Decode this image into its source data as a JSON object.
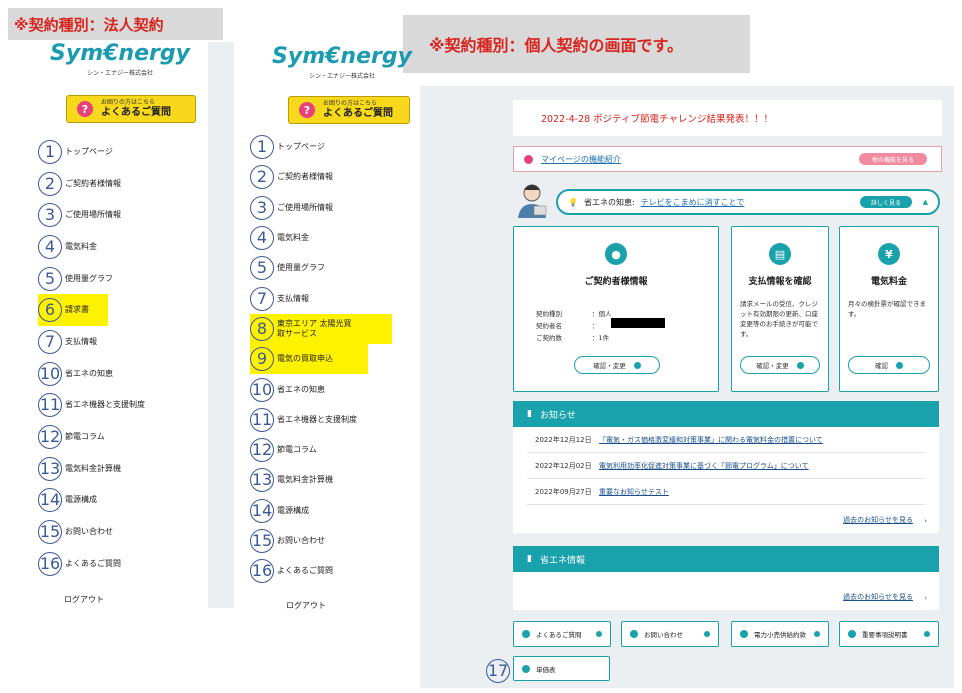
{
  "banners": {
    "left": "※契約種別：法人契約",
    "right": "※契約種別：個人契約の画面です。"
  },
  "logo": {
    "brand": "Sym€nergy",
    "sub": "シン・エナジー株式会社"
  },
  "faq": {
    "line1": "お困りの方はこちら",
    "line2": "よくあるご質問"
  },
  "nav_corporate": [
    {
      "num": "1",
      "label": "トップページ"
    },
    {
      "num": "2",
      "label": "ご契約者様情報"
    },
    {
      "num": "3",
      "label": "ご使用場所情報"
    },
    {
      "num": "4",
      "label": "電気料金"
    },
    {
      "num": "5",
      "label": "使用量グラフ"
    },
    {
      "num": "6",
      "label": "請求書"
    },
    {
      "num": "7",
      "label": "支払情報"
    },
    {
      "num": "10",
      "label": "省エネの知恵"
    },
    {
      "num": "11",
      "label": "省エネ機器と支援制度"
    },
    {
      "num": "12",
      "label": "節電コラム"
    },
    {
      "num": "13",
      "label": "電気料金計算機"
    },
    {
      "num": "14",
      "label": "電源構成"
    },
    {
      "num": "15",
      "label": "お問い合わせ"
    },
    {
      "num": "16",
      "label": "よくあるご質問"
    }
  ],
  "nav_personal": [
    {
      "num": "1",
      "label": "トップページ"
    },
    {
      "num": "2",
      "label": "ご契約者様情報"
    },
    {
      "num": "3",
      "label": "ご使用場所情報"
    },
    {
      "num": "4",
      "label": "電気料金"
    },
    {
      "num": "5",
      "label": "使用量グラフ"
    },
    {
      "num": "7",
      "label": "支払情報"
    },
    {
      "num": "8",
      "label": "東京エリア 太陽光買取サービス"
    },
    {
      "num": "9",
      "label": "電気の買取申込"
    },
    {
      "num": "10",
      "label": "省エネの知恵"
    },
    {
      "num": "11",
      "label": "省エネ機器と支援制度"
    },
    {
      "num": "12",
      "label": "節電コラム"
    },
    {
      "num": "13",
      "label": "電気料金計算機"
    },
    {
      "num": "14",
      "label": "電源構成"
    },
    {
      "num": "15",
      "label": "お問い合わせ"
    },
    {
      "num": "16",
      "label": "よくあるご質問"
    }
  ],
  "logout": "ログアウト",
  "announcement": "2022-4-28 ポジティブ節電チャレンジ結果発表！！！",
  "feature": {
    "link": "マイページの機能紹介",
    "button": "他の機能を見る"
  },
  "tips": {
    "label": "省エネの知恵:",
    "link": "テレビをこまめに消すことで",
    "button": "詳しく見る"
  },
  "contract_card": {
    "title": "ご契約者様情報",
    "rows": [
      {
        "k": "契約種別",
        "v": "：個人"
      },
      {
        "k": "契約者名",
        "v": "："
      },
      {
        "k": "ご契約数",
        "v": "：1件"
      }
    ],
    "button": "確認・変更"
  },
  "payment_card": {
    "title": "支払情報を確認",
    "desc": "請求メールの受信、クレジット有効期限の更新、口座変更等のお手続きが可能です。",
    "button": "確認・変更"
  },
  "fee_card": {
    "title": "電気料金",
    "desc": "月々の検針票が確認できます。",
    "button": "確認"
  },
  "news": {
    "title": "お知らせ",
    "items": [
      {
        "date": "2022年12月12日",
        "text": "「電気・ガス価格激変緩和対策事業」に関わる電気料金の措置について"
      },
      {
        "date": "2022年12月02日",
        "text": "電気利用効率化促進対策事業に基づく「節電プログラム」について"
      },
      {
        "date": "2022年09月27日",
        "text": "重要なお知らせテスト"
      }
    ],
    "more": "過去のお知らせを見る"
  },
  "energy": {
    "title": "省エネ情報",
    "more": "過去のお知らせを見る"
  },
  "link_buttons": [
    "よくあるご質問",
    "お問い合わせ",
    "電力小売供給約款",
    "重要事項説明書"
  ],
  "unit_price": {
    "num": "17",
    "label": "単価表"
  },
  "colors": {
    "teal": "#1aa2ac",
    "red": "#d9231d",
    "yellow": "#fff200",
    "pink": "#e7407a"
  }
}
